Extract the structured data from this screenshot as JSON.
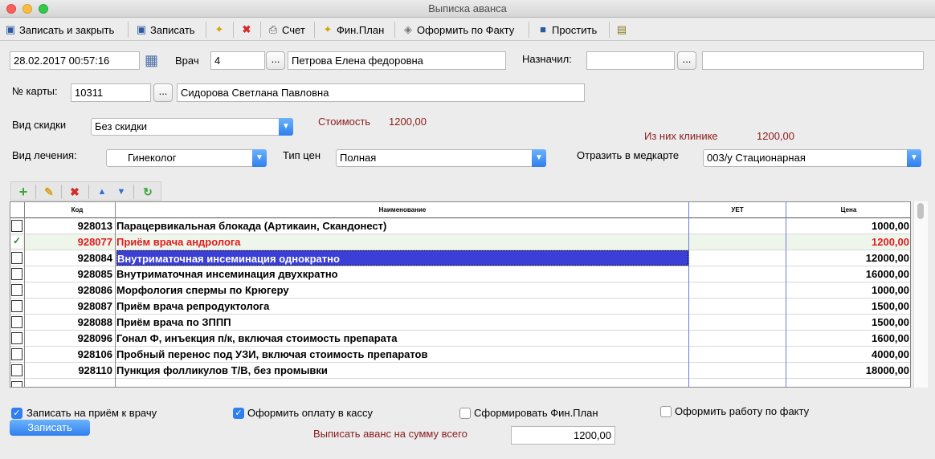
{
  "window": {
    "title": "Выписка аванса"
  },
  "toolbar": {
    "save_close": "Записать и закрыть",
    "save": "Записать",
    "invoice": "Счет",
    "fin_plan": "Фин.План",
    "by_fact": "Оформить по Факту",
    "forgive": "Простить"
  },
  "form": {
    "date": "28.02.2017 00:57:16",
    "doctor_label": "Врач",
    "doctor_code": "4",
    "doctor_name": "Петрова Елена федоровна",
    "assigned_label": "Назначил:",
    "assigned_code": "",
    "assigned_name": "",
    "card_label": "№ карты:",
    "card_number": "10311",
    "patient_name": "Сидорова Светлана Павловна",
    "discount_label": "Вид скидки",
    "discount_value": "Без скидки",
    "cost_label": "Стоимость",
    "cost_value": "1200,00",
    "clinic_label": "Из них клинике",
    "clinic_value": "1200,00",
    "treatment_label": "Вид лечения:",
    "treatment_value": "Гинеколог",
    "price_type_label": "Тип цен",
    "price_type_value": "Полная",
    "medcard_label": "Отразить в медкарте",
    "medcard_value": "003/у Стационарная",
    "dots": "..."
  },
  "table": {
    "headers": {
      "code": "Код",
      "name": "Наименование",
      "uet": "УЕТ",
      "price": "Цена"
    },
    "rows": [
      {
        "code": "928013",
        "name": "Парацервикальная блокада (Артикаин, Скандонест)",
        "uet": "",
        "price": "1000,00",
        "checked": false
      },
      {
        "code": "928077",
        "name": "Приём врача андролога",
        "uet": "",
        "price": "1200,00",
        "checked": true
      },
      {
        "code": "928084",
        "name": "Внутриматочная инсеминация однократно",
        "uet": "",
        "price": "12000,00",
        "checked": false
      },
      {
        "code": "928085",
        "name": "Внутриматочная инсеминация двухкратно",
        "uet": "",
        "price": "16000,00",
        "checked": false
      },
      {
        "code": "928086",
        "name": "Морфология спермы по Крюгеру",
        "uet": "",
        "price": "1000,00",
        "checked": false
      },
      {
        "code": "928087",
        "name": "Приём врача репродуктолога",
        "uet": "",
        "price": "1500,00",
        "checked": false
      },
      {
        "code": "928088",
        "name": "Приём врача по ЗППП",
        "uet": "",
        "price": "1500,00",
        "checked": false
      },
      {
        "code": "928096",
        "name": "Гонал Ф, инъекция п/к, включая стоимость препарата",
        "uet": "",
        "price": "1600,00",
        "checked": false
      },
      {
        "code": "928106",
        "name": "Пробный перенос под УЗИ, включая стоимость препаратов",
        "uet": "",
        "price": "4000,00",
        "checked": false
      },
      {
        "code": "928110",
        "name": "Пункция фолликулов Т/В, без промывки",
        "uet": "",
        "price": "18000,00",
        "checked": false
      }
    ]
  },
  "bottom": {
    "record_appointment": "Записать на приём к врачу",
    "pay_cashier": "Оформить оплату в кассу",
    "form_fin_plan": "Сформировать Фин.План",
    "work_by_fact": "Оформить работу по факту",
    "save_button": "Записать",
    "total_label": "Выписать аванс на сумму всего",
    "total_value": "1200,00"
  },
  "colors": {
    "accent": "#2f7ff0",
    "selected_row": "#3b3fd8",
    "red_text": "#8b1c1c",
    "checked_row_text": "#e21b1b"
  }
}
